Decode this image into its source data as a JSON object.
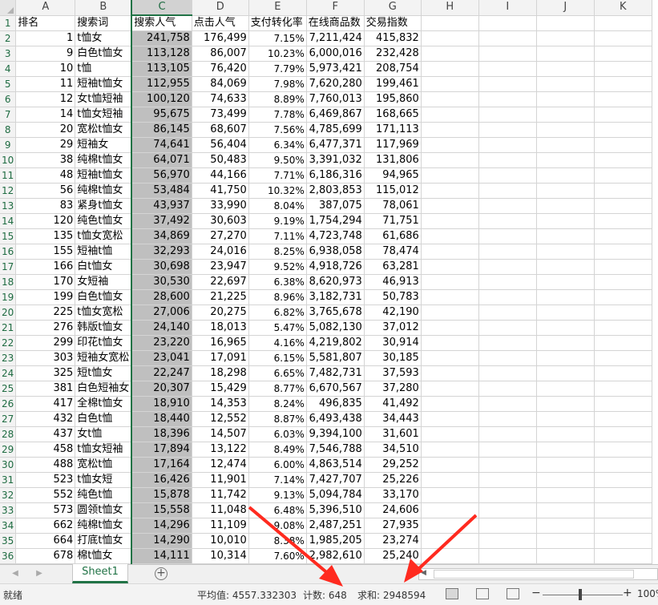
{
  "columns": [
    "A",
    "B",
    "C",
    "D",
    "E",
    "F",
    "G",
    "H",
    "I",
    "J",
    "K"
  ],
  "header_row": [
    "排名",
    "搜索词",
    "搜索人气",
    "点击人气",
    "支付转化率",
    "在线商品数",
    "交易指数"
  ],
  "rows": [
    [
      "1",
      "t恤女",
      "241,758",
      "176,499",
      "7.15%",
      "7,211,424",
      "415,832"
    ],
    [
      "9",
      "白色t恤女",
      "113,128",
      "86,007",
      "10.23%",
      "6,000,016",
      "232,428"
    ],
    [
      "10",
      "t恤",
      "113,105",
      "76,420",
      "7.79%",
      "5,973,421",
      "208,754"
    ],
    [
      "11",
      "短袖t恤女",
      "112,955",
      "84,069",
      "7.98%",
      "7,620,280",
      "199,461"
    ],
    [
      "12",
      "女t恤短袖",
      "100,120",
      "74,633",
      "8.89%",
      "7,760,013",
      "195,860"
    ],
    [
      "14",
      "t恤女短袖",
      "95,675",
      "73,499",
      "7.78%",
      "6,469,867",
      "168,665"
    ],
    [
      "20",
      "宽松t恤女",
      "86,145",
      "68,607",
      "7.56%",
      "4,785,699",
      "171,113"
    ],
    [
      "29",
      "短袖女",
      "74,641",
      "56,404",
      "6.34%",
      "6,477,371",
      "117,969"
    ],
    [
      "38",
      "纯棉t恤女",
      "64,071",
      "50,483",
      "9.50%",
      "3,391,032",
      "131,806"
    ],
    [
      "48",
      "短袖t恤女",
      "56,970",
      "44,166",
      "7.71%",
      "6,186,316",
      "94,965"
    ],
    [
      "56",
      "纯棉t恤女",
      "53,484",
      "41,750",
      "10.32%",
      "2,803,853",
      "115,012"
    ],
    [
      "83",
      "紧身t恤女",
      "43,937",
      "33,990",
      "8.04%",
      "387,075",
      "78,061"
    ],
    [
      "120",
      "纯色t恤女",
      "37,492",
      "30,603",
      "9.19%",
      "1,754,294",
      "71,751"
    ],
    [
      "135",
      "t恤女宽松",
      "34,869",
      "27,270",
      "7.11%",
      "4,723,748",
      "61,686"
    ],
    [
      "155",
      "短袖t恤",
      "32,293",
      "24,016",
      "8.25%",
      "6,938,058",
      "78,474"
    ],
    [
      "166",
      "白t恤女",
      "30,698",
      "23,947",
      "9.52%",
      "4,918,726",
      "63,281"
    ],
    [
      "170",
      "女短袖",
      "30,530",
      "22,697",
      "6.38%",
      "8,620,973",
      "46,913"
    ],
    [
      "199",
      "白色t恤女",
      "28,600",
      "21,225",
      "8.96%",
      "3,182,731",
      "50,783"
    ],
    [
      "225",
      "t恤女宽松",
      "27,006",
      "20,275",
      "6.82%",
      "3,765,678",
      "42,190"
    ],
    [
      "276",
      "韩版t恤女",
      "24,140",
      "18,013",
      "5.47%",
      "5,082,130",
      "37,012"
    ],
    [
      "299",
      "印花t恤女",
      "23,220",
      "16,965",
      "4.16%",
      "4,219,802",
      "30,914"
    ],
    [
      "303",
      "短袖女宽松",
      "23,041",
      "17,091",
      "6.15%",
      "5,581,807",
      "30,185"
    ],
    [
      "325",
      "短t恤女",
      "22,247",
      "18,298",
      "6.65%",
      "7,482,731",
      "37,593"
    ],
    [
      "381",
      "白色短袖女",
      "20,307",
      "15,429",
      "8.77%",
      "6,670,567",
      "37,280"
    ],
    [
      "417",
      "全棉t恤女",
      "18,910",
      "14,353",
      "8.24%",
      "496,835",
      "41,492"
    ],
    [
      "432",
      "白色t恤",
      "18,440",
      "12,552",
      "8.87%",
      "6,493,438",
      "34,443"
    ],
    [
      "437",
      "女t恤",
      "18,396",
      "14,507",
      "6.03%",
      "9,394,100",
      "31,601"
    ],
    [
      "458",
      "t恤女短袖",
      "17,894",
      "13,122",
      "8.49%",
      "7,546,788",
      "34,510"
    ],
    [
      "488",
      "宽松t恤",
      "17,164",
      "12,474",
      "6.00%",
      "4,863,514",
      "29,252"
    ],
    [
      "523",
      "t恤女短",
      "16,426",
      "11,901",
      "7.14%",
      "7,427,707",
      "25,226"
    ],
    [
      "552",
      "纯色t恤",
      "15,878",
      "11,742",
      "9.13%",
      "5,094,784",
      "33,170"
    ],
    [
      "573",
      "圆领t恤女",
      "15,558",
      "11,048",
      "6.48%",
      "5,396,510",
      "24,606"
    ],
    [
      "662",
      "纯棉t恤女",
      "14,296",
      "11,109",
      "9.08%",
      "2,487,251",
      "27,935"
    ],
    [
      "664",
      "打底t恤女",
      "14,290",
      "10,010",
      "8.38%",
      "1,985,205",
      "23,274"
    ],
    [
      "678",
      "棉t恤女",
      "14,111",
      "10,314",
      "7.60%",
      "2,982,610",
      "25,240"
    ]
  ],
  "sheet_tab": "Sheet1",
  "status": {
    "ready": "就绪",
    "average": "平均值: 4557.332303",
    "count": "计数: 648",
    "sum": "求和: 2948594",
    "zoom": "100%"
  },
  "colors": {
    "accent": "#217346",
    "selection_fill": "#bfbfbf",
    "annotation_arrow": "#ff2a1f"
  }
}
